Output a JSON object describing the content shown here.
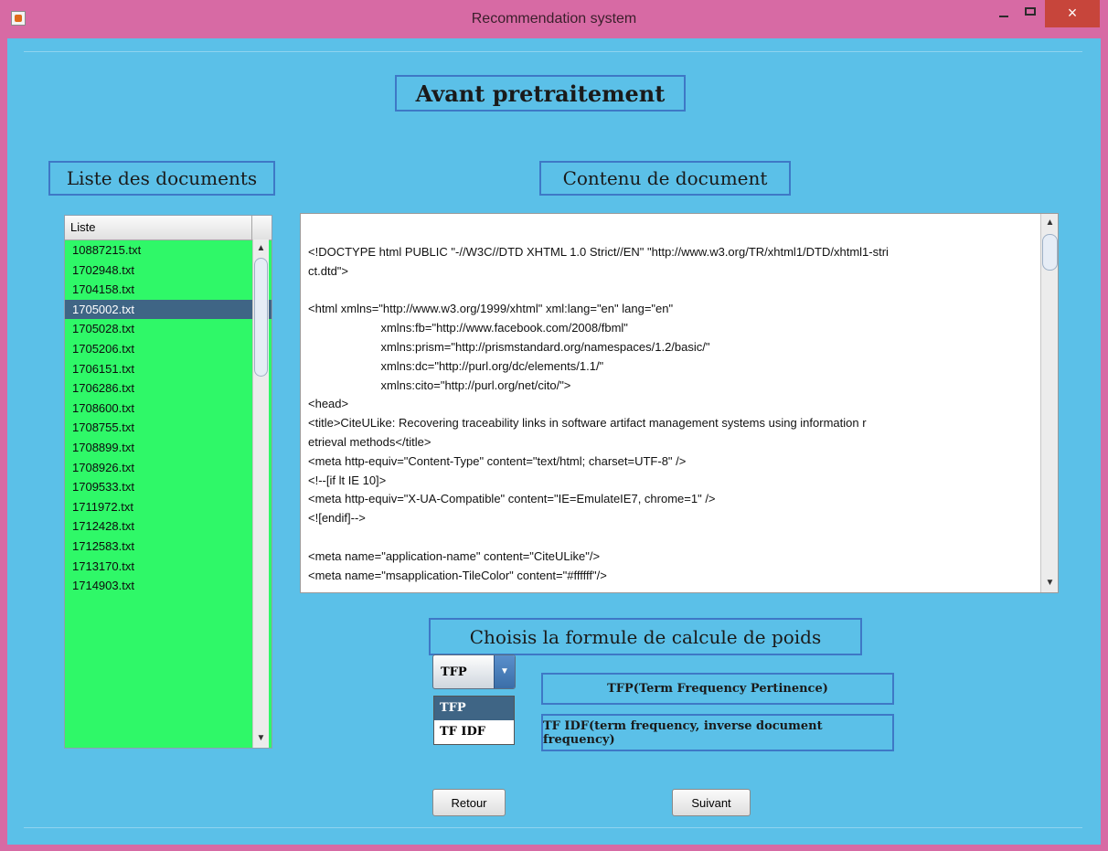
{
  "window": {
    "title": "Recommendation system",
    "close_symbol": "×"
  },
  "page": {
    "heading": "Avant pretraitement",
    "doc_list_label": "Liste des documents",
    "doc_content_label": "Contenu de document",
    "formula_label": "Choisis la formule de calcule de poids"
  },
  "document_list": {
    "header": "Liste",
    "selected": "1705002.txt",
    "items": [
      "10887215.txt",
      "1702948.txt",
      "1704158.txt",
      "1705002.txt",
      "1705028.txt",
      "1705206.txt",
      "1706151.txt",
      "1706286.txt",
      "1708600.txt",
      "1708755.txt",
      "1708899.txt",
      "1708926.txt",
      "1709533.txt",
      "1711972.txt",
      "1712428.txt",
      "1712583.txt",
      "1713170.txt",
      "1714903.txt"
    ],
    "scroll_up": "▲",
    "scroll_down": "▼"
  },
  "document_content": {
    "lines": [
      "<!DOCTYPE html PUBLIC \"-//W3C//DTD XHTML 1.0 Strict//EN\" \"http://www.w3.org/TR/xhtml1/DTD/xhtml1-stri",
      "ct.dtd\">",
      "",
      "<html xmlns=\"http://www.w3.org/1999/xhtml\" xml:lang=\"en\" lang=\"en\"",
      "                      xmlns:fb=\"http://www.facebook.com/2008/fbml\"",
      "                      xmlns:prism=\"http://prismstandard.org/namespaces/1.2/basic/\"",
      "                      xmlns:dc=\"http://purl.org/dc/elements/1.1/\"",
      "                      xmlns:cito=\"http://purl.org/net/cito/\">",
      "<head>",
      "<title>CiteULike: Recovering traceability links in software artifact management systems using information r",
      "etrieval methods</title>",
      "<meta http-equiv=\"Content-Type\" content=\"text/html; charset=UTF-8\" />",
      "<!--[if lt IE 10]>",
      "<meta http-equiv=\"X-UA-Compatible\" content=\"IE=EmulateIE7, chrome=1\" />",
      "<![endif]-->",
      "",
      "<meta name=\"application-name\" content=\"CiteULike\"/>",
      "<meta name=\"msapplication-TileColor\" content=\"#ffffff\"/>"
    ],
    "scroll_up": "▲",
    "scroll_down": "▼"
  },
  "formula": {
    "selected": "TFP",
    "options": [
      "TFP",
      "TF IDF"
    ],
    "dropdown_arrow": "▼",
    "descriptions": {
      "tfp": "TFP(Term Frequency Pertinence)",
      "tfidf": "TF IDF(term frequency, inverse document frequency)"
    }
  },
  "buttons": {
    "back": "Retour",
    "next": "Suivant"
  },
  "colors": {
    "window_frame": "#d76aa4",
    "content_bg": "#5bc0e8",
    "list_bg": "#2ff868",
    "selection": "#3f6585",
    "label_border": "#3e78c6",
    "close_button": "#c7453b"
  }
}
